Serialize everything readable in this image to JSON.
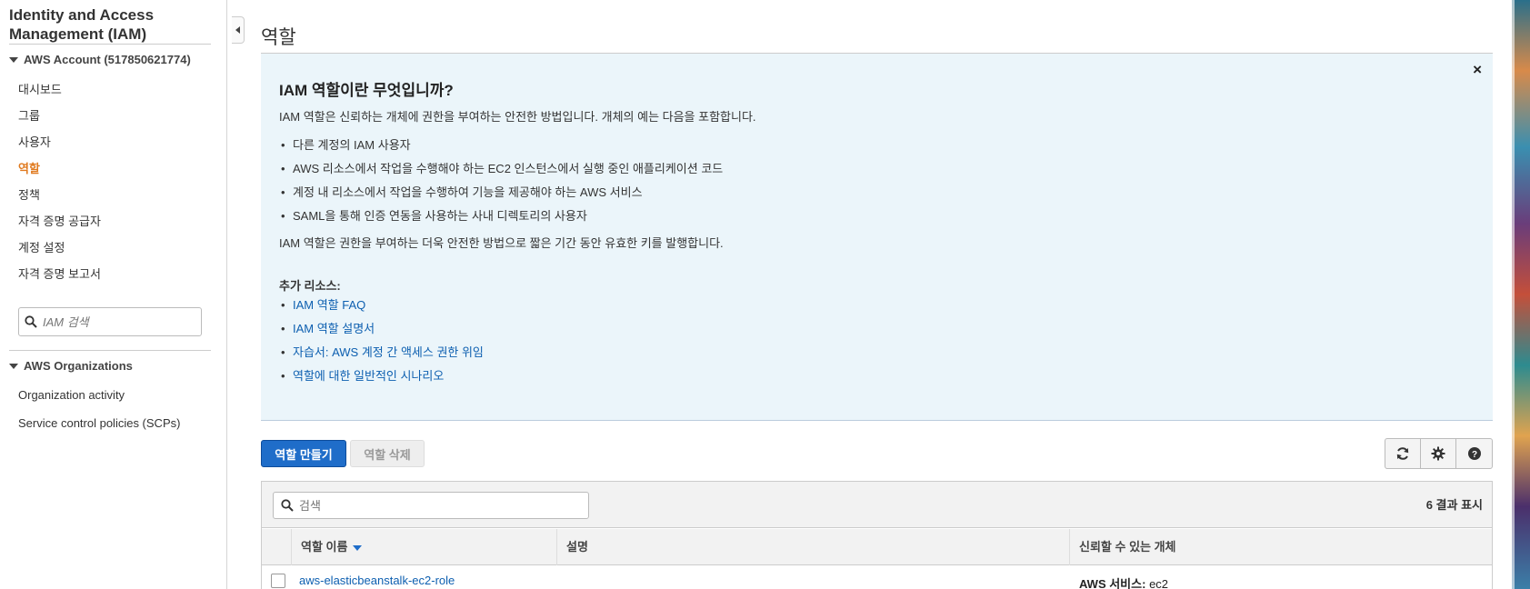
{
  "sidebar": {
    "service_title": "Identity and Access Management (IAM)",
    "account_section": "AWS Account (517850621774)",
    "items": [
      {
        "label": "대시보드"
      },
      {
        "label": "그룹"
      },
      {
        "label": "사용자"
      },
      {
        "label": "역할",
        "active": true
      },
      {
        "label": "정책"
      },
      {
        "label": "자격 증명 공급자"
      },
      {
        "label": "계정 설정"
      },
      {
        "label": "자격 증명 보고서"
      }
    ],
    "search_placeholder": "IAM 검색",
    "org_section": "AWS Organizations",
    "org_items": [
      {
        "label": "Organization activity"
      },
      {
        "label": "Service control policies (SCPs)"
      }
    ]
  },
  "main": {
    "page_title": "역할",
    "info": {
      "heading": "IAM 역할이란 무엇입니까?",
      "intro": "IAM 역할은 신뢰하는 개체에 권한을 부여하는 안전한 방법입니다. 개체의 예는 다음을 포함합니다.",
      "bullets": [
        "다른 계정의 IAM 사용자",
        "AWS 리소스에서 작업을 수행해야 하는 EC2 인스턴스에서 실행 중인 애플리케이션 코드",
        "계정 내 리소스에서 작업을 수행하여 기능을 제공해야 하는 AWS 서비스",
        "SAML을 통해 인증 연동을 사용하는 사내 디렉토리의 사용자"
      ],
      "outro": "IAM 역할은 권한을 부여하는 더욱 안전한 방법으로 짧은 기간 동안 유효한 키를 발행합니다.",
      "resources_heading": "추가 리소스:",
      "links": [
        "IAM 역할 FAQ",
        "IAM 역할 설명서",
        "자습서: AWS 계정 간 액세스 권한 위임",
        "역할에 대한 일반적인 시나리오"
      ],
      "close_label": "×"
    },
    "toolbar": {
      "create_label": "역할 만들기",
      "delete_label": "역할 삭제"
    },
    "table": {
      "search_placeholder": "검색",
      "result_count": "6 결과 표시",
      "columns": [
        "역할 이름",
        "설명",
        "신뢰할 수 있는 개체"
      ],
      "rows": [
        {
          "name": "aws-elasticbeanstalk-ec2-role",
          "description": "",
          "trusted_prefix": "AWS 서비스:",
          "trusted_value": "ec2"
        }
      ]
    }
  },
  "colors": {
    "accent_orange": "#e07a1f",
    "primary_blue": "#1f6dc9",
    "link_blue": "#0d5fb0",
    "info_bg": "#ebf5fa"
  }
}
